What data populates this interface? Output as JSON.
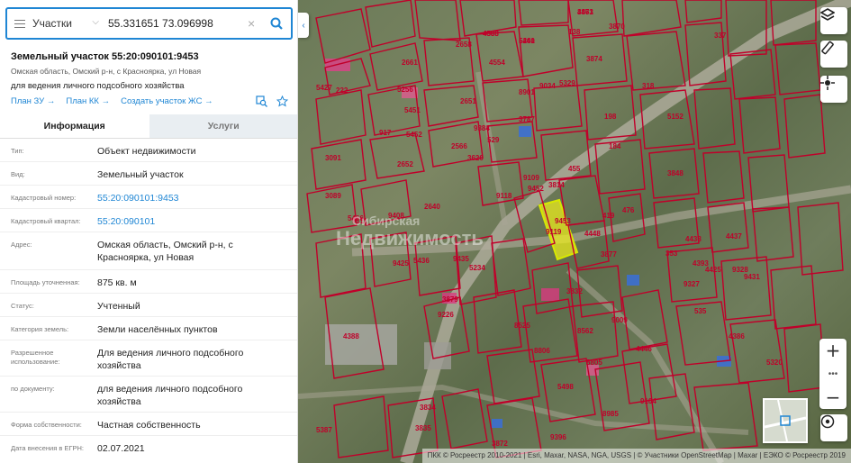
{
  "search": {
    "layer": "Участки",
    "query": "55.331651 73.096998"
  },
  "parcel": {
    "title": "Земельный участок 55:20:090101:9453",
    "address_line": "Омская область, Омский р-н, с Красноярка, ул Новая",
    "usage_line": "для ведения личного подсобного хозяйства",
    "links": [
      "План ЗУ →",
      "План КК →",
      "Создать участок ЖС →"
    ]
  },
  "tabs": [
    {
      "label": "Информация",
      "active": true
    },
    {
      "label": "Услуги",
      "active": false
    }
  ],
  "properties": [
    {
      "key": "Тип:",
      "value": "Объект недвижимости",
      "link": false
    },
    {
      "key": "Вид:",
      "value": "Земельный участок",
      "link": false
    },
    {
      "key": "Кадастровый номер:",
      "value": "55:20:090101:9453",
      "link": true
    },
    {
      "key": "Кадастровый квартал:",
      "value": "55:20:090101",
      "link": true
    },
    {
      "key": "Адрес:",
      "value": "Омская область, Омский р-н, с Красноярка, ул Новая",
      "link": false
    },
    {
      "key": "Площадь уточненная:",
      "value": "875 кв. м",
      "link": false
    },
    {
      "key": "Статус:",
      "value": "Учтенный",
      "link": false
    },
    {
      "key": "Категория земель:",
      "value": "Земли населённых пунктов",
      "link": false
    },
    {
      "key": "Разрешенное использование:",
      "value": "Для ведения личного подсобного хозяйства",
      "link": false
    },
    {
      "key": "по документу:",
      "value": "для ведения личного подсобного хозяйства",
      "link": false
    },
    {
      "key": "Форма собственности:",
      "value": "Частная собственность",
      "link": false
    },
    {
      "key": "Дата внесения в ЕГРН:",
      "value": "02.07.2021",
      "link": false
    }
  ],
  "map": {
    "watermark_line1": "Сибирская",
    "watermark_line2": "Недвижимость",
    "attribution": "ПКК © Росреестр 2010-2021 | Esri, Maxar, NASA, NGA, USGS | © Участники OpenStreetMap | Maxar | ЕЭКО © Росреестр 2019",
    "zoom_in": "+",
    "zoom_out": "−",
    "parcel_labels": [
      "3871",
      "4508",
      "5260",
      "138",
      "3870",
      "337",
      "3874",
      "2658",
      "4554",
      "2661",
      "5256",
      "8901",
      "9034",
      "318",
      "5427",
      "2651",
      "3787",
      "222",
      "5329",
      "5451",
      "9384",
      "5452",
      "198",
      "917",
      "5152",
      "529",
      "3091",
      "2652",
      "2566",
      "3620",
      "184",
      "455",
      "9109",
      "3089",
      "5466",
      "9118",
      "9452",
      "3814",
      "9453",
      "476",
      "419",
      "4438",
      "4437",
      "9119",
      "4448",
      "2640",
      "9408",
      "9425",
      "5436",
      "9435",
      "5234",
      "3879",
      "9226",
      "3832",
      "353",
      "4393",
      "4425",
      "9328",
      "9327",
      "4388",
      "8525",
      "8806",
      "8562",
      "9009",
      "535",
      "4386",
      "4446",
      "8805",
      "5320",
      "5498",
      "3834",
      "8985",
      "9104",
      "5387",
      "9396",
      "3835",
      "3872",
      "9111",
      "9431",
      "3848",
      "3877",
      "4463",
      "4385",
      "5441"
    ],
    "selected_parcel": "9453"
  },
  "colors": {
    "accent": "#1f86d4",
    "parcel_border": "#c0002a",
    "selected_fill": "#f2f21a"
  }
}
